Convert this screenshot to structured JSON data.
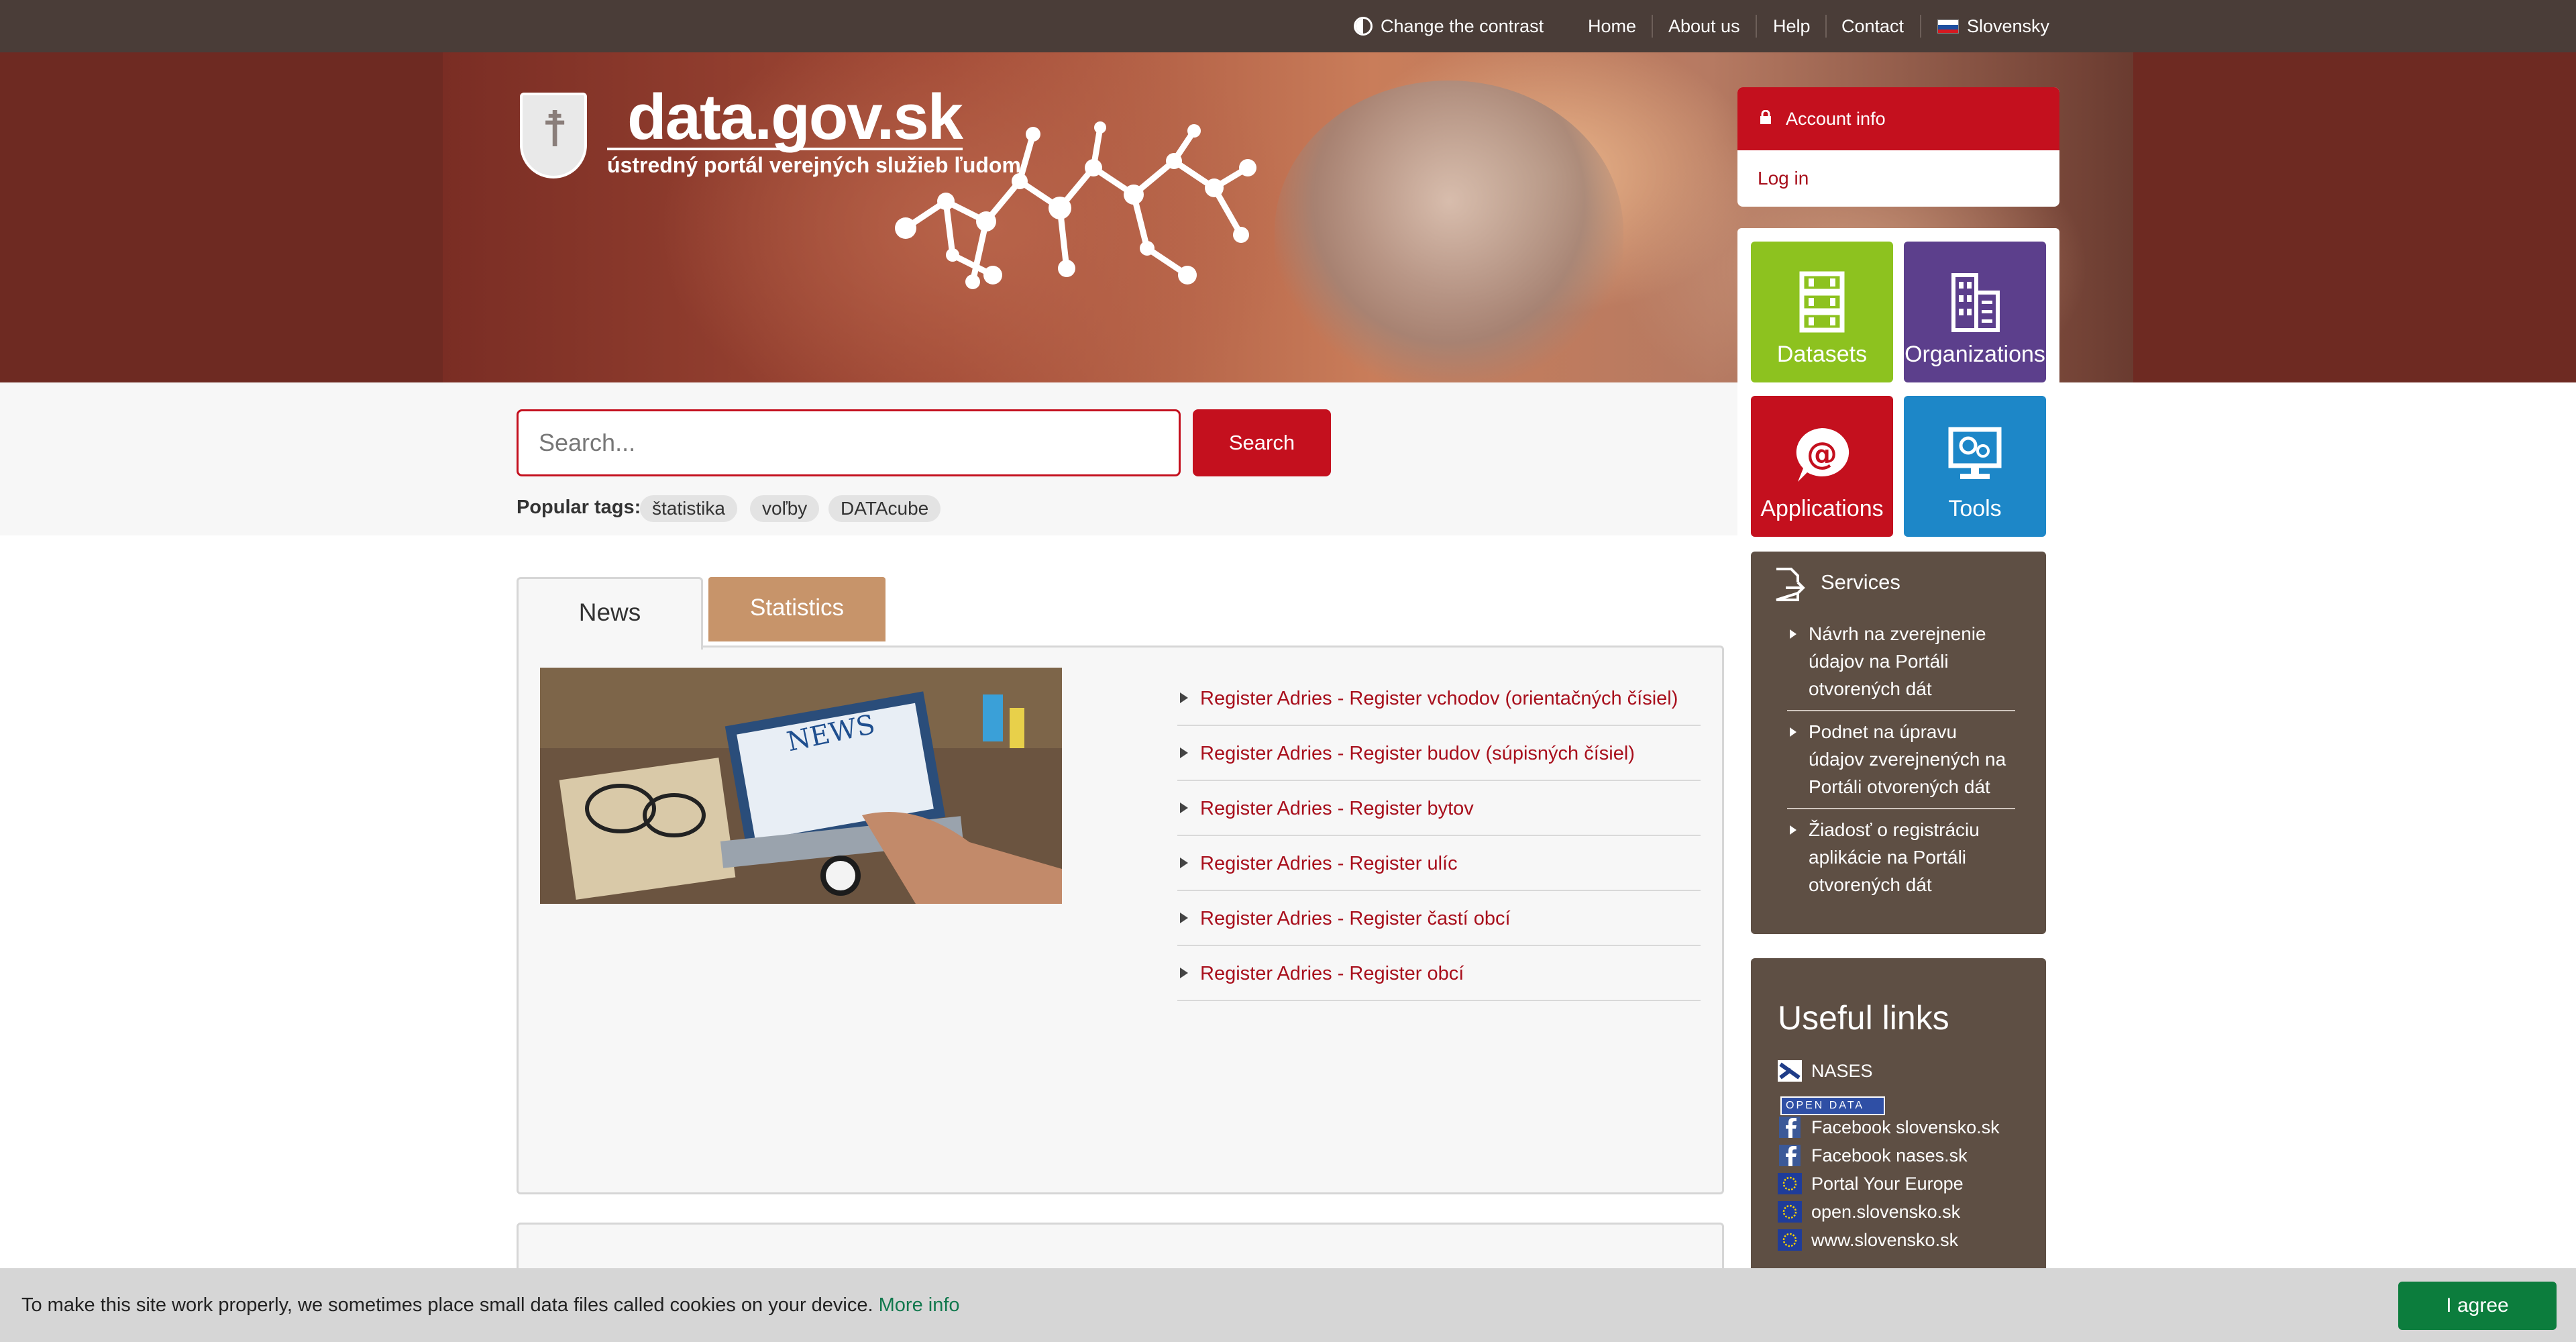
{
  "topbar": {
    "contrast_label": "Change the contrast",
    "nav": [
      "Home",
      "About us",
      "Help",
      "Contact"
    ],
    "language": "Slovensky"
  },
  "logo": {
    "title": "data.gov.sk",
    "subtitle": "ústredný portál verejných služieb ľudom"
  },
  "search": {
    "placeholder": "Search...",
    "button_label": "Search",
    "tags_label": "Popular tags:",
    "tags": [
      "štatistika",
      "voľby",
      "DATAcube"
    ]
  },
  "tabs": {
    "news": "News",
    "statistics": "Statistics"
  },
  "news": {
    "image_caption": "NEWS",
    "items": [
      "Register Adries - Register vchodov (orientačných čísiel)",
      "Register Adries - Register budov (súpisných čísiel)",
      "Register Adries - Register bytov",
      "Register Adries - Register ulíc",
      "Register Adries - Register častí obcí",
      "Register Adries - Register obcí"
    ]
  },
  "account": {
    "header": "Account info",
    "login": "Log in"
  },
  "tiles": {
    "datasets": "Datasets",
    "organizations": "Organizations",
    "applications": "Applications",
    "tools": "Tools"
  },
  "services": {
    "title": "Services",
    "items": [
      "Návrh na zverejnenie údajov na Portáli otvorených dát",
      "Podnet na úpravu údajov zverejnených na Portáli otvorených dát",
      "Žiadosť o registráciu aplikácie na Portáli otvorených dát"
    ]
  },
  "useful_links": {
    "title": "Useful links",
    "open_data_badge": "OPEN DATA",
    "items": [
      "NASES",
      "Facebook slovensko.sk",
      "Facebook nases.sk",
      "Portal Your Europe",
      "open.slovensko.sk",
      "www.slovensko.sk"
    ]
  },
  "cookie": {
    "text": "To make this site work properly, we sometimes place small data files called cookies on your device.",
    "more_info": "More info",
    "agree": "I agree"
  },
  "colors": {
    "topbar": "#4a3d38",
    "brand_red": "#c4101e",
    "link_red": "#a80f1c",
    "sidebar_brown": "#5e4f44",
    "statistics_tab": "#c7946a",
    "datasets_tile": "#8dc21f",
    "organizations_tile": "#5c3f8c",
    "applications_tile": "#c4101e",
    "tools_tile": "#1d87c8",
    "agree_green": "#0c7d3d"
  }
}
